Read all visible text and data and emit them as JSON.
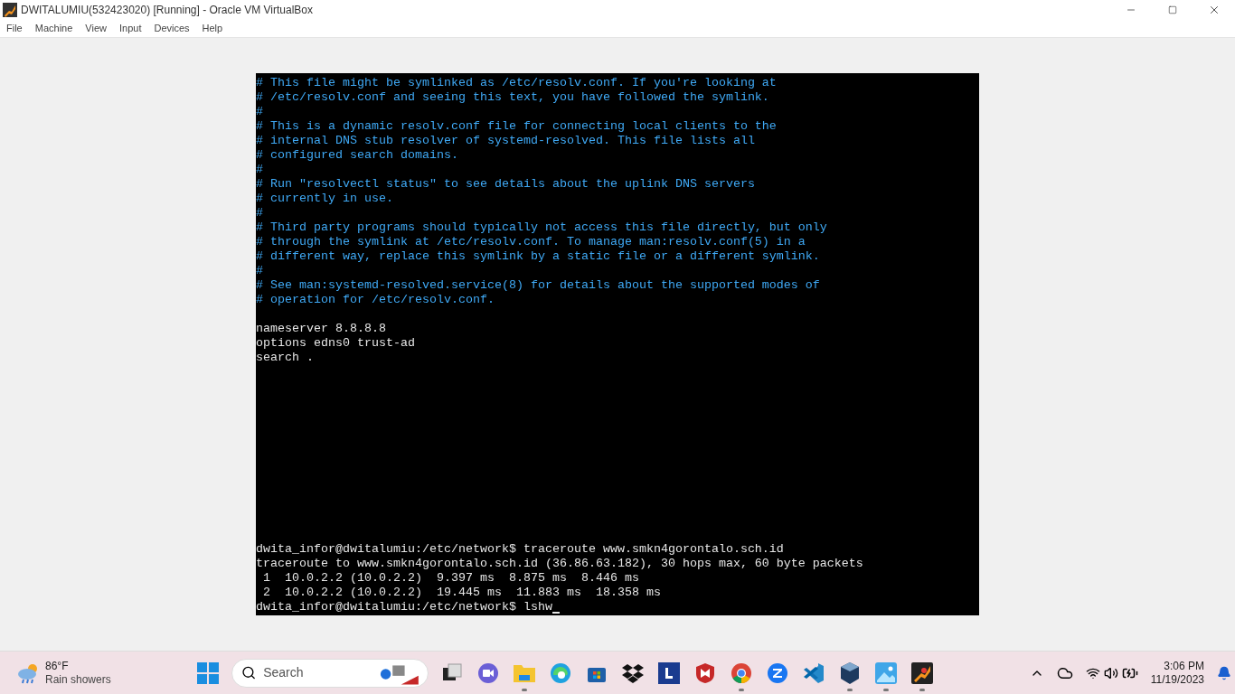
{
  "window": {
    "title": "DWITALUMIU(532423020) [Running] - Oracle VM VirtualBox"
  },
  "menu": [
    "File",
    "Machine",
    "View",
    "Input",
    "Devices",
    "Help"
  ],
  "terminal": {
    "top_lines": [
      {
        "kind": "comment",
        "text": "# This file might be symlinked as /etc/resolv.conf. If you're looking at"
      },
      {
        "kind": "comment",
        "text": "# /etc/resolv.conf and seeing this text, you have followed the symlink."
      },
      {
        "kind": "comment",
        "text": "#"
      },
      {
        "kind": "comment",
        "text": "# This is a dynamic resolv.conf file for connecting local clients to the"
      },
      {
        "kind": "comment",
        "text": "# internal DNS stub resolver of systemd-resolved. This file lists all"
      },
      {
        "kind": "comment",
        "text": "# configured search domains."
      },
      {
        "kind": "comment",
        "text": "#"
      },
      {
        "kind": "comment",
        "text": "# Run \"resolvectl status\" to see details about the uplink DNS servers"
      },
      {
        "kind": "comment",
        "text": "# currently in use."
      },
      {
        "kind": "comment",
        "text": "#"
      },
      {
        "kind": "comment",
        "text": "# Third party programs should typically not access this file directly, but only"
      },
      {
        "kind": "comment",
        "text": "# through the symlink at /etc/resolv.conf. To manage man:resolv.conf(5) in a"
      },
      {
        "kind": "comment",
        "text": "# different way, replace this symlink by a static file or a different symlink."
      },
      {
        "kind": "comment",
        "text": "#"
      },
      {
        "kind": "comment",
        "text": "# See man:systemd-resolved.service(8) for details about the supported modes of"
      },
      {
        "kind": "comment",
        "text": "# operation for /etc/resolv.conf."
      },
      {
        "kind": "blank"
      },
      {
        "kind": "plain",
        "text": "nameserver 8.8.8.8"
      },
      {
        "kind": "plain",
        "text": "options edns0 trust-ad"
      },
      {
        "kind": "plain",
        "text": "search ."
      }
    ],
    "bottom_lines": [
      {
        "kind": "plain",
        "text": "dwita_infor@dwitalumiu:/etc/network$ traceroute www.smkn4gorontalo.sch.id"
      },
      {
        "kind": "plain",
        "text": "traceroute to www.smkn4gorontalo.sch.id (36.86.63.182), 30 hops max, 60 byte packets"
      },
      {
        "kind": "plain",
        "text": " 1  10.0.2.2 (10.0.2.2)  9.397 ms  8.875 ms  8.446 ms"
      },
      {
        "kind": "plain",
        "text": " 2  10.0.2.2 (10.0.2.2)  19.445 ms  11.883 ms  18.358 ms"
      },
      {
        "kind": "plain",
        "text": "dwita_infor@dwitalumiu:/etc/network$ lshw",
        "cursor": true
      }
    ]
  },
  "taskbar": {
    "weather": {
      "temp": "86°F",
      "condition": "Rain showers"
    },
    "search": {
      "placeholder": "Search"
    },
    "apps": [
      {
        "kind": "taskview",
        "running": false
      },
      {
        "kind": "meet",
        "running": false
      },
      {
        "kind": "folder",
        "running": true
      },
      {
        "kind": "edge",
        "running": false
      },
      {
        "kind": "store",
        "running": false
      },
      {
        "kind": "dropbox",
        "running": false
      },
      {
        "kind": "lapp",
        "running": false
      },
      {
        "kind": "shield",
        "running": false
      },
      {
        "kind": "chrome",
        "running": true
      },
      {
        "kind": "zapp",
        "running": false
      },
      {
        "kind": "code",
        "running": false
      },
      {
        "kind": "cube",
        "running": true
      },
      {
        "kind": "photos",
        "running": true
      },
      {
        "kind": "vbox",
        "running": true
      }
    ],
    "time": "3:06 PM",
    "date": "11/19/2023"
  }
}
